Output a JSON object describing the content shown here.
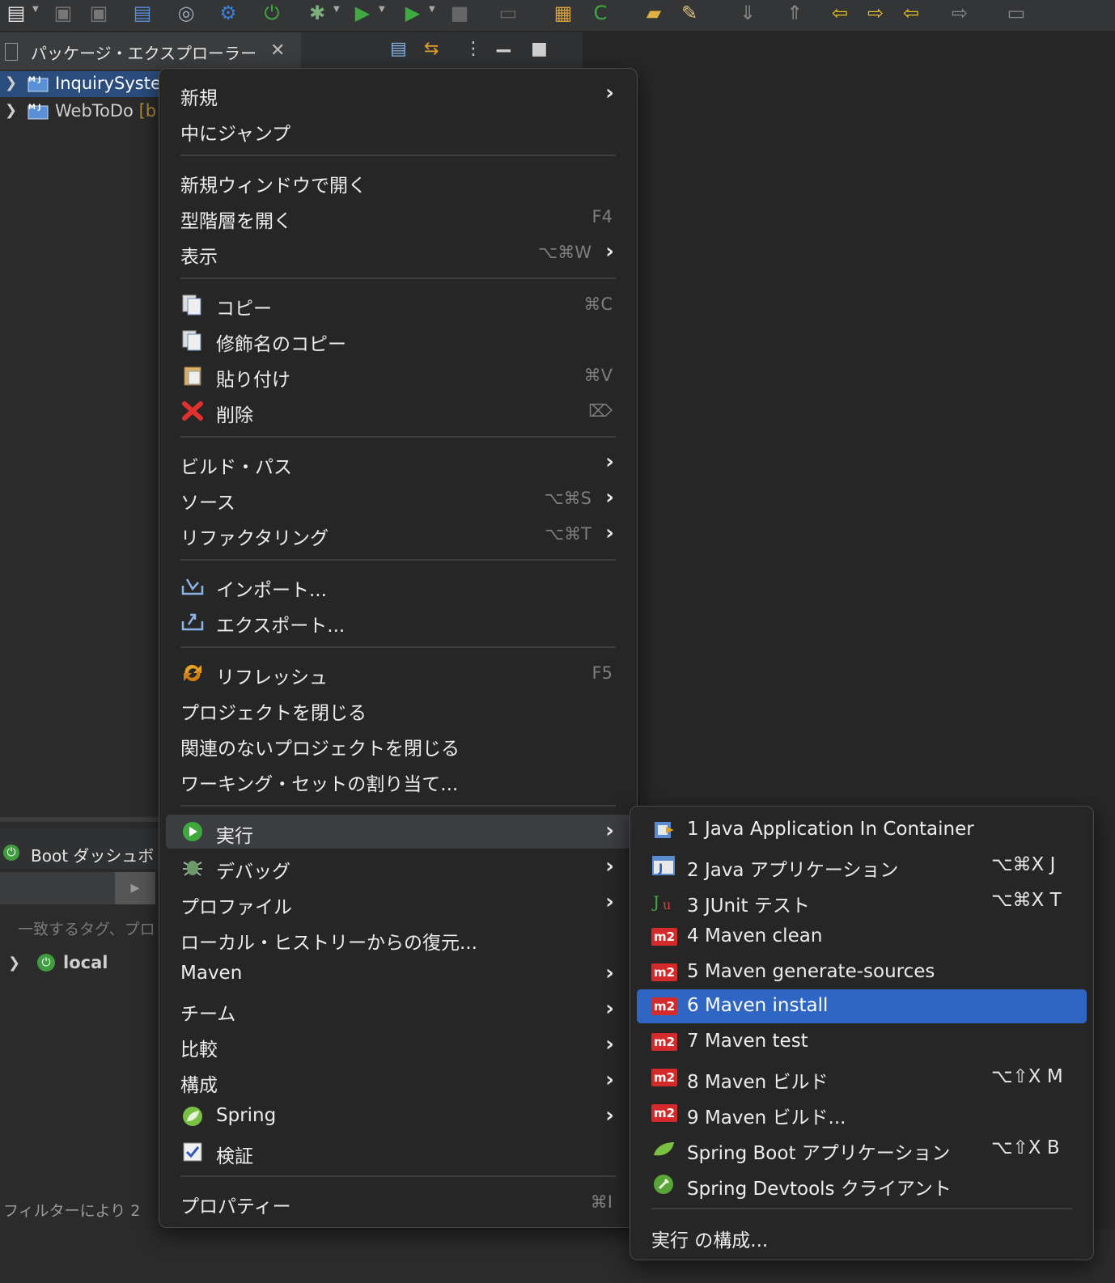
{
  "package_explorer": {
    "title": "パッケージ・エクスプローラー",
    "projects": [
      {
        "name": "InquirySyste",
        "decoration": ""
      },
      {
        "name": "WebToDo",
        "decoration": "[b"
      }
    ]
  },
  "boot_dashboard": {
    "title": "Boot ダッシュボ",
    "filter_hint": "一致するタグ、プロ",
    "node": "local"
  },
  "status": {
    "text": "フィルターにより 2"
  },
  "context_menu": {
    "new": "新規",
    "go_into": "中にジャンプ",
    "open_new_window": "新規ウィンドウで開く",
    "open_type_hierarchy": {
      "label": "型階層を開く",
      "shortcut": "F4"
    },
    "show": {
      "label": "表示",
      "shortcut": "⌥⌘W"
    },
    "copy": {
      "label": "コピー",
      "shortcut": "⌘C"
    },
    "copy_qualified": "修飾名のコピー",
    "paste": {
      "label": "貼り付け",
      "shortcut": "⌘V"
    },
    "delete": {
      "label": "削除",
      "shortcut": "⌦"
    },
    "build_path": "ビルド・パス",
    "source": {
      "label": "ソース",
      "shortcut": "⌥⌘S"
    },
    "refactor": {
      "label": "リファクタリング",
      "shortcut": "⌥⌘T"
    },
    "import": "インポート...",
    "export": "エクスポート...",
    "refresh": {
      "label": "リフレッシュ",
      "shortcut": "F5"
    },
    "close_project": "プロジェクトを閉じる",
    "close_unrelated": "関連のないプロジェクトを閉じる",
    "assign_working_sets": "ワーキング・セットの割り当て...",
    "run_as": "実行",
    "debug_as": "デバッグ",
    "profile_as": "プロファイル",
    "restore_local_history": "ローカル・ヒストリーからの復元...",
    "maven": "Maven",
    "team": "チーム",
    "compare_with": "比較",
    "configure": "構成",
    "spring": "Spring",
    "validate": "検証",
    "properties": {
      "label": "プロパティー",
      "shortcut": "⌘I"
    }
  },
  "run_submenu": {
    "items": [
      {
        "label": "1 Java Application In Container",
        "shortcut": "",
        "icon": "java-container-icon"
      },
      {
        "label": "2 Java アプリケーション",
        "shortcut": "⌥⌘X J",
        "icon": "java-app-icon"
      },
      {
        "label": "3 JUnit テスト",
        "shortcut": "⌥⌘X T",
        "icon": "junit-icon"
      },
      {
        "label": "4 Maven clean",
        "shortcut": "",
        "icon": "m2-icon"
      },
      {
        "label": "5 Maven generate-sources",
        "shortcut": "",
        "icon": "m2-icon"
      },
      {
        "label": "6 Maven install",
        "shortcut": "",
        "icon": "m2-icon"
      },
      {
        "label": "7 Maven test",
        "shortcut": "",
        "icon": "m2-icon"
      },
      {
        "label": "8 Maven ビルド",
        "shortcut": "⌥⇧X M",
        "icon": "m2-icon"
      },
      {
        "label": "9 Maven ビルド...",
        "shortcut": "",
        "icon": "m2-icon"
      },
      {
        "label": "Spring Boot アプリケーション",
        "shortcut": "⌥⇧X B",
        "icon": "spring-boot-icon"
      },
      {
        "label": "Spring Devtools クライアント",
        "shortcut": "",
        "icon": "devtools-icon"
      }
    ],
    "run_configurations": "実行 の構成..."
  },
  "colors": {
    "selection": "#2f66c4",
    "menu_bg": "#262626",
    "hover": "#3b3d40"
  }
}
